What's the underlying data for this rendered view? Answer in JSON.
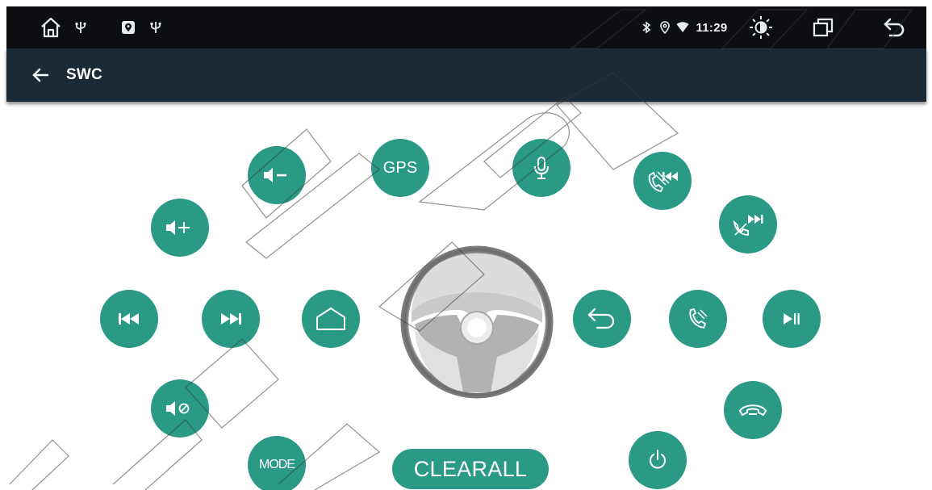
{
  "status_bar": {
    "left_icons": [
      "home-icon",
      "usb-icon",
      "location-badge-icon",
      "usb-icon"
    ],
    "right_icons": [
      "bluetooth-icon",
      "location-icon",
      "wifi-icon"
    ],
    "time": "11:29",
    "actions": [
      "brightness-icon",
      "recent-apps-icon",
      "back-icon"
    ]
  },
  "title_bar": {
    "back_icon": "arrow-left-icon",
    "title": "SWC"
  },
  "colors": {
    "accent": "#2a9a86",
    "status_bar_bg": "#0c0e12",
    "title_bar_bg": "#1c2a36",
    "wheel": "#7b7b7b"
  },
  "controls": {
    "gps_label": "GPS",
    "mode_label": "MODE",
    "clear_all_label": "CLEARALL",
    "icon_buttons": [
      "volume-down-icon",
      "microphone-icon",
      "call-prev-track-icon",
      "call-next-track-icon",
      "volume-up-icon",
      "previous-track-icon",
      "next-track-icon",
      "home-outline-icon",
      "return-icon",
      "phone-call-icon",
      "play-pause-icon",
      "mute-icon",
      "hang-up-icon",
      "power-icon"
    ],
    "center_icon": "steering-wheel-icon"
  }
}
